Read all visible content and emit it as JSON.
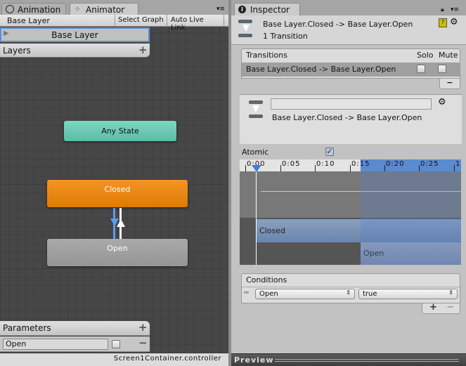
{
  "animator": {
    "tabs": [
      {
        "label": "Animation",
        "icon": "clock-icon"
      },
      {
        "label": "Animator",
        "icon": "animator-icon",
        "active": true
      }
    ],
    "breadcrumb": "Base Layer",
    "select_graph": "Select Graph",
    "auto_live_link": "Auto Live Link",
    "layer_item": "Base Layer",
    "layers_label": "Layers",
    "states": {
      "any_state": "Any State",
      "closed": "Closed",
      "open": "Open"
    },
    "state_colors": {
      "any_state": "#6dcbb5",
      "closed": "#e8820f",
      "open": "#a0a0a0"
    },
    "parameters_label": "Parameters",
    "parameter": {
      "name": "Open",
      "value": false
    },
    "footer": "Screen1Container.controller"
  },
  "inspector": {
    "tab": "Inspector",
    "title": "Base Layer.Closed -> Base Layer.Open",
    "subtitle": "1 Transition",
    "transitions": {
      "header": "Transitions",
      "solo": "Solo",
      "mute": "Mute",
      "rows": [
        {
          "name": "Base Layer.Closed -> Base Layer.Open",
          "solo": false,
          "mute": false
        }
      ]
    },
    "detail": {
      "name_value": "",
      "label": "Base Layer.Closed -> Base Layer.Open"
    },
    "atomic": {
      "label": "Atomic",
      "checked": true
    },
    "timeline": {
      "ticks": [
        "0:00",
        "0:05",
        "0:10",
        "0:15",
        "0:20",
        "0:25",
        "1"
      ],
      "source": "Closed",
      "destination": "Open",
      "accent": "#5a8ad0"
    },
    "conditions": {
      "header": "Conditions",
      "rows": [
        {
          "parameter": "Open",
          "value": "true"
        }
      ]
    },
    "preview": "Preview"
  }
}
